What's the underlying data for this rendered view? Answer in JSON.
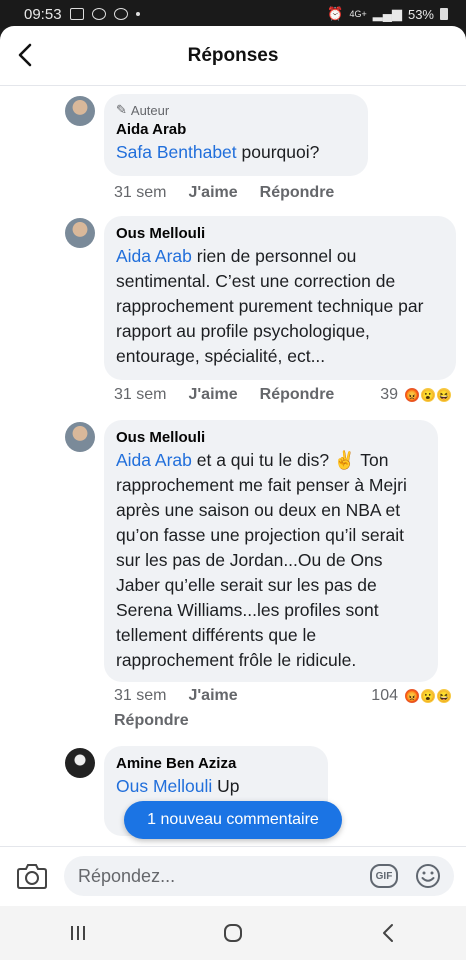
{
  "status": {
    "time": "09:53",
    "battery": "53%",
    "network": "4G+"
  },
  "header": {
    "title": "Réponses"
  },
  "comments": [
    {
      "badge": "Auteur",
      "author": "Aida Arab",
      "mention": "Safa Benthabet",
      "text": " pourquoi?",
      "time": "31 sem",
      "like": "J'aime",
      "reply": "Répondre"
    },
    {
      "author": "Ous Mellouli",
      "mention": "Aida Arab",
      "text": " rien de personnel ou sentimental. C’est une correction de rapprochement purement technique par rapport au profile psychologique, entourage, spécialité, ect...",
      "time": "31 sem",
      "like": "J'aime",
      "reply": "Répondre",
      "reactions": "39"
    },
    {
      "author": "Ous Mellouli",
      "mention": "Aida Arab",
      "text": " et a qui tu le dis? ✌️ Ton rapprochement me fait penser à Mejri après une saison ou deux en NBA et qu’on fasse une projection qu’il serait sur les pas de Jordan...Ou de Ons Jaber qu’elle serait sur les pas de Serena Williams...les profiles sont tellement différents que le rapprochement frôle le ridicule.",
      "time": "31 sem",
      "like": "J'aime",
      "reply": "Répondre",
      "reactions": "104"
    },
    {
      "author": "Amine Ben Aziza",
      "mention": "Ous Mellouli",
      "text": " Up"
    }
  ],
  "new_comment_label": "1 nouveau commentaire",
  "composer": {
    "placeholder": "Répondez...",
    "gif_label": "GIF"
  },
  "icons": {
    "back": "chevron-left-icon",
    "camera": "camera-icon",
    "emoji": "smiley-icon",
    "angry": "angry-reaction-icon",
    "wow": "wow-reaction-icon",
    "haha": "haha-reaction-icon"
  },
  "colors": {
    "mention": "#216fdb",
    "pill": "#1b74e4",
    "bubble": "#f0f2f5"
  }
}
